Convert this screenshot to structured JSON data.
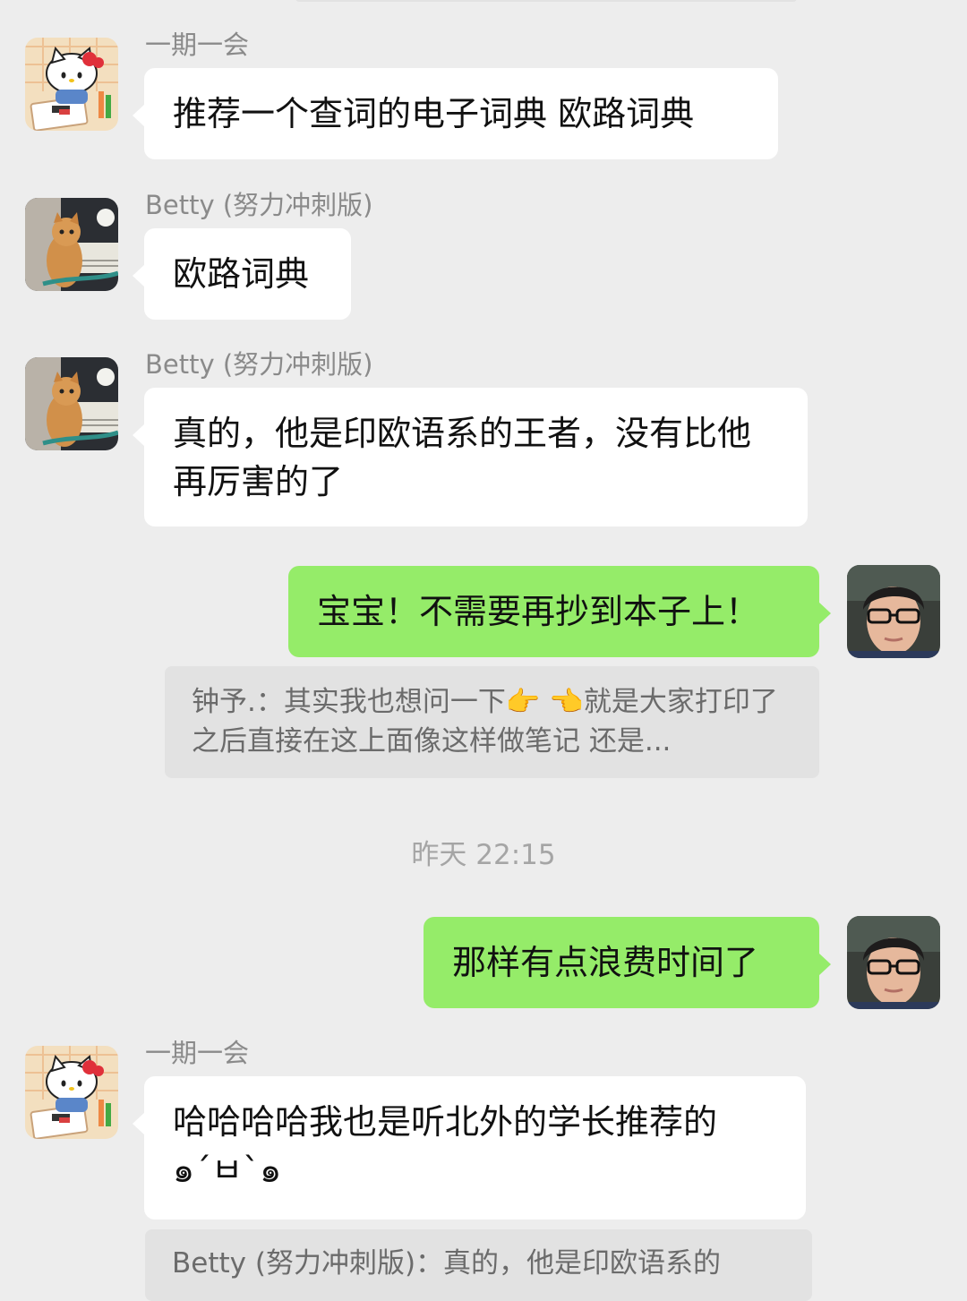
{
  "messages": [
    {
      "sender": "一期一会",
      "text": "推荐一个查词的电子词典 欧路词典",
      "avatar": "hello-kitty-avatar"
    },
    {
      "sender": "Betty (努力冲刺版)",
      "text": "欧路词典",
      "avatar": "cat-avatar"
    },
    {
      "sender": "Betty (努力冲刺版)",
      "text": "真的，他是印欧语系的王者，没有比他再厉害的了",
      "avatar": "cat-avatar"
    },
    {
      "sender": "",
      "text": "宝宝！不需要再抄到本子上！",
      "avatar": "self-avatar"
    },
    {
      "quote": "钟予.：其实我也想问一下👉 👈就是大家打印了之后直接在这上面像这样做笔记 还是..."
    },
    {
      "timestamp": "昨天 22:15"
    },
    {
      "sender": "",
      "text": "那样有点浪费时间了",
      "avatar": "self-avatar"
    },
    {
      "sender": "一期一会",
      "text": "哈哈哈哈我也是听北外的学长推荐的\n๑´ㅂ`๑",
      "avatar": "hello-kitty-avatar"
    },
    {
      "quote": "Betty (努力冲刺版)：真的，他是印欧语系的"
    }
  ],
  "colors": {
    "background": "#ededed",
    "incoming_bubble": "#ffffff",
    "outgoing_bubble": "#95ec69",
    "quote_bg": "#e2e2e2",
    "sender_text": "#8a8a8a"
  }
}
